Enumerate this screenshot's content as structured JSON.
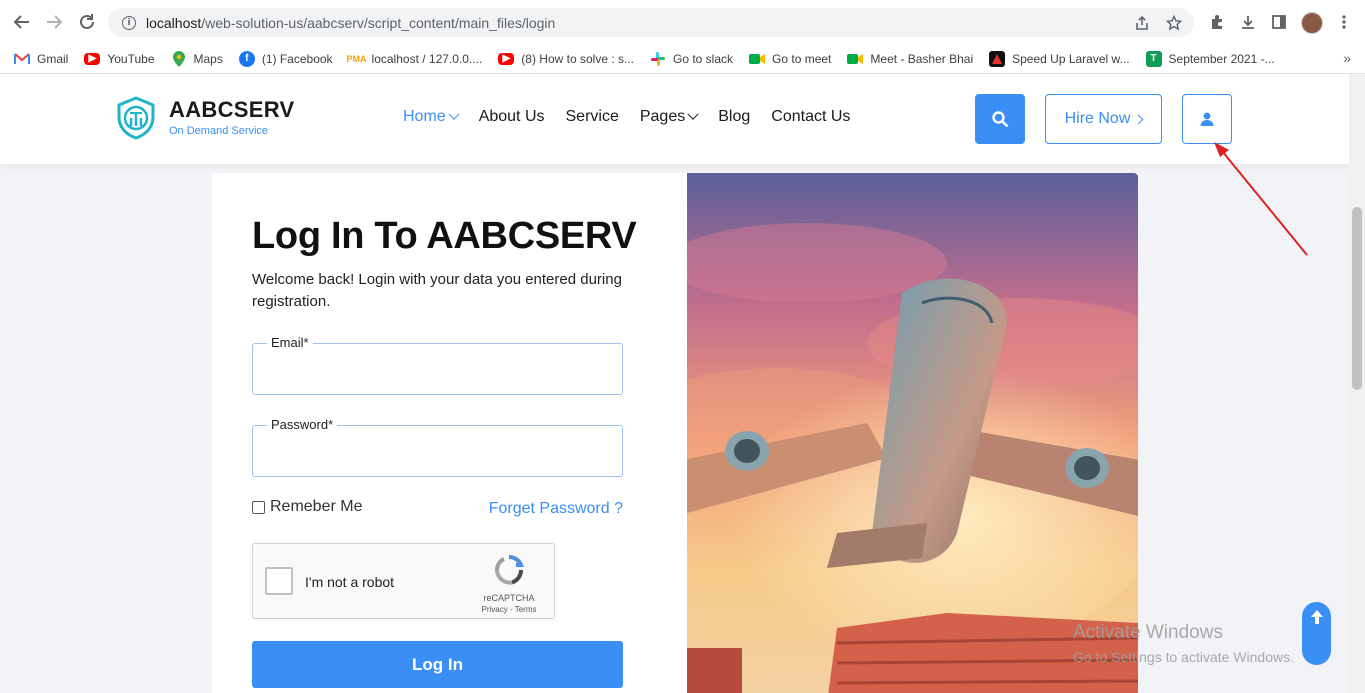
{
  "browser": {
    "url_host": "localhost",
    "url_path": "/web-solution-us/aabcserv/script_content/main_files/login",
    "bookmarks": [
      {
        "label": "Gmail",
        "icon": "gmail-icon"
      },
      {
        "label": "YouTube",
        "icon": "youtube-icon"
      },
      {
        "label": "Maps",
        "icon": "maps-icon"
      },
      {
        "label": "(1) Facebook",
        "icon": "facebook-icon"
      },
      {
        "label": "localhost / 127.0.0....",
        "icon": "phpmyadmin-icon"
      },
      {
        "label": "(8) How to solve : s...",
        "icon": "youtube-icon"
      },
      {
        "label": "Go to slack",
        "icon": "slack-icon"
      },
      {
        "label": "Go to meet",
        "icon": "meet-icon"
      },
      {
        "label": "Meet - Basher Bhai",
        "icon": "meet-icon"
      },
      {
        "label": "Speed Up Laravel w...",
        "icon": "laravel-icon"
      },
      {
        "label": "September 2021 -...",
        "icon": "sheets-icon"
      }
    ],
    "more": "»"
  },
  "site": {
    "logo_title": "AABCSERV",
    "logo_subtitle": "On Demand Service",
    "menu": [
      {
        "label": "Home",
        "dropdown": true,
        "active": true
      },
      {
        "label": "About Us",
        "dropdown": false,
        "active": false
      },
      {
        "label": "Service",
        "dropdown": false,
        "active": false
      },
      {
        "label": "Pages",
        "dropdown": true,
        "active": false
      },
      {
        "label": "Blog",
        "dropdown": false,
        "active": false
      },
      {
        "label": "Contact Us",
        "dropdown": false,
        "active": false
      }
    ],
    "hire_label": "Hire Now",
    "accent": "#3a8ef5"
  },
  "login": {
    "title": "Log In To AABCSERV",
    "welcome": "Welcome back! Login with your data you entered during registration.",
    "email_label": "Email*",
    "email_value": "",
    "password_label": "Password*",
    "password_value": "",
    "remember_label": "Remeber Me",
    "forgot_label": "Forget Password ?",
    "captcha_text": "I'm not a robot",
    "captcha_brand": "reCAPTCHA",
    "captcha_terms": "Privacy - Terms",
    "submit_label": "Log In"
  },
  "windows": {
    "line1": "Activate Windows",
    "line2": "Go to Settings to activate Windows."
  }
}
